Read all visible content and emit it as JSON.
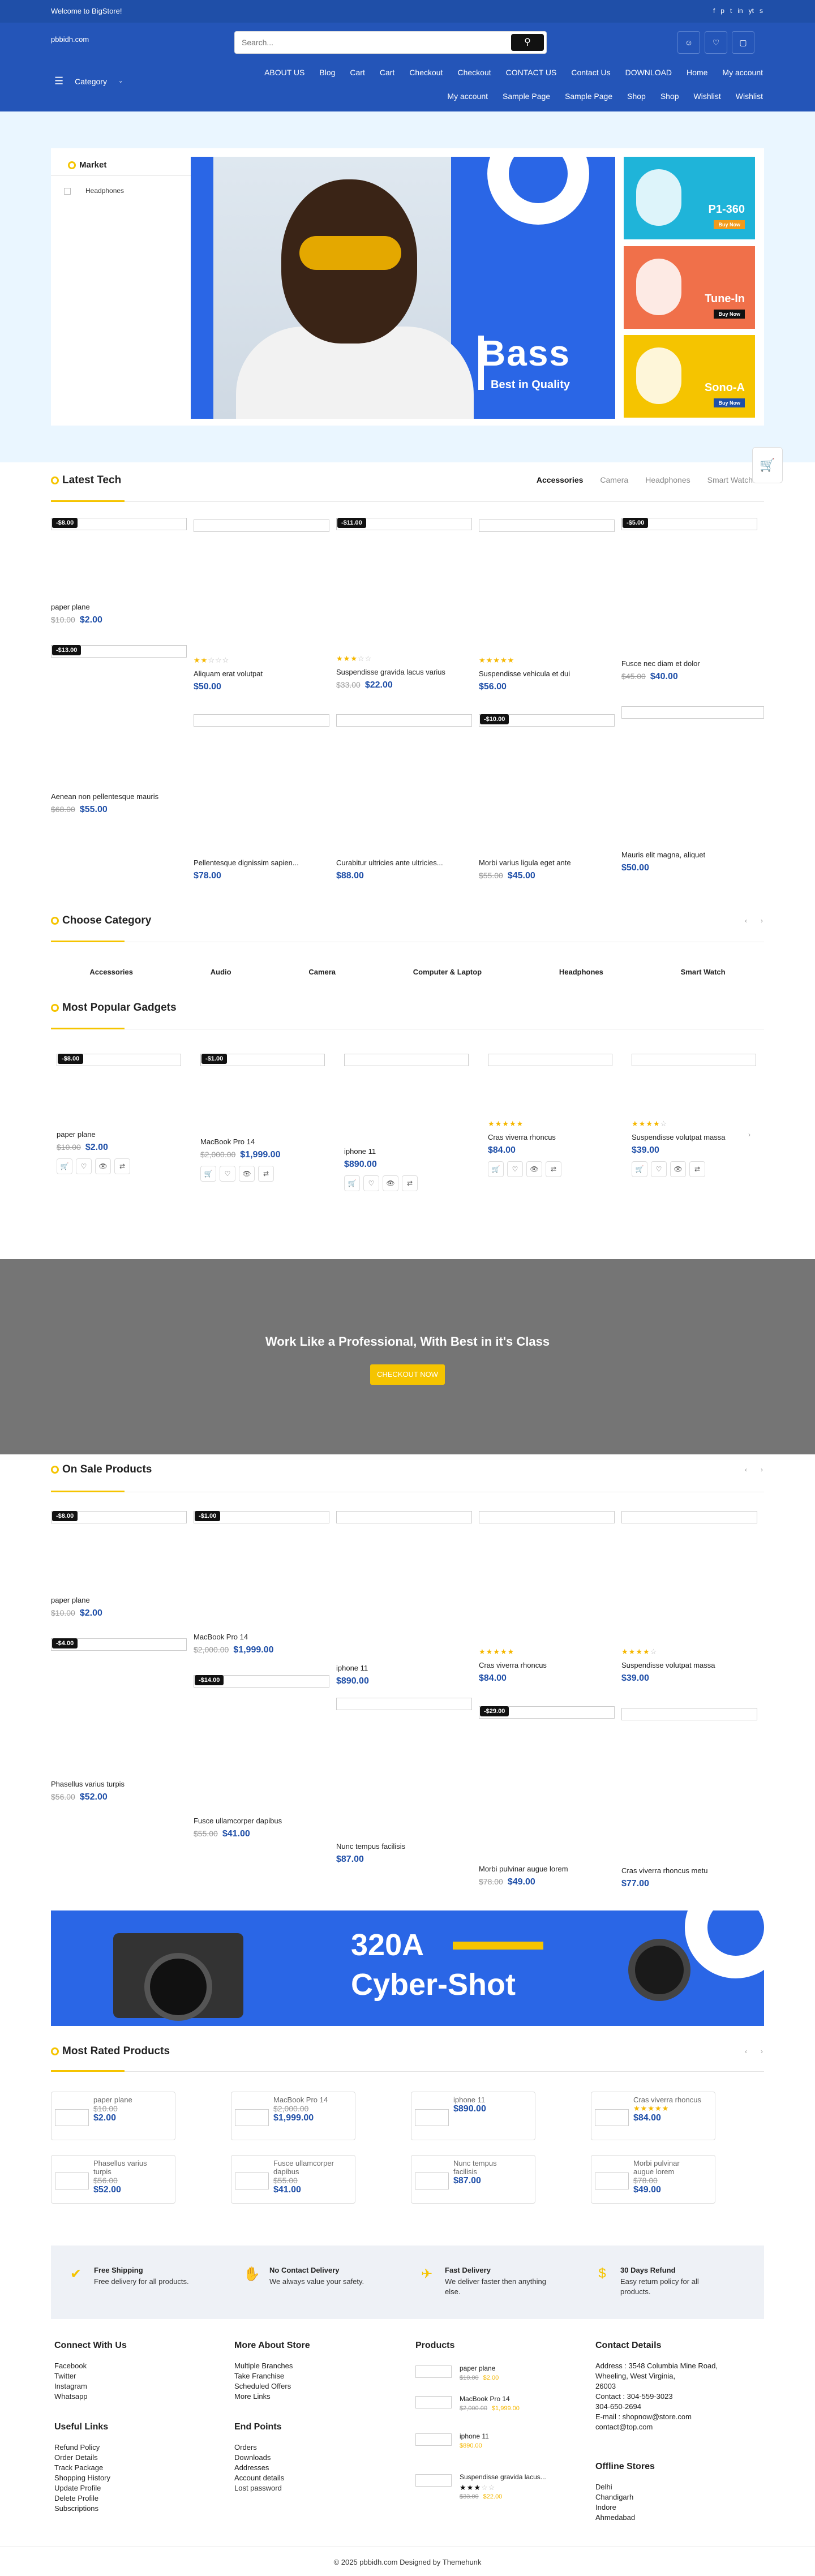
{
  "topbar": {
    "welcome": "Welcome to BigStore!",
    "social": [
      "f",
      "p",
      "t",
      "in",
      "yt",
      "s"
    ]
  },
  "header": {
    "logo_alt": "pbbidh.com",
    "search_placeholder": "Search...",
    "search_icon": "search-icon",
    "icons": [
      "user-icon",
      "heart-icon",
      "bag-icon"
    ]
  },
  "nav": {
    "category": "Category",
    "menu_row1": [
      "ABOUT US",
      "Blog",
      "Cart",
      "Cart",
      "Checkout",
      "Checkout",
      "CONTACT US",
      "Contact Us",
      "DOWNLOAD",
      "Home",
      "My account"
    ],
    "menu_row2": [
      "My account",
      "Sample Page",
      "Sample Page",
      "Shop",
      "Shop",
      "Wishlist",
      "Wishlist"
    ]
  },
  "hero": {
    "market": "Market",
    "sidebar_item": "Headphones",
    "main_title": "Bass",
    "main_sub": "Best in Quality",
    "banners": [
      {
        "title": "P1-360",
        "btn": "Buy Now",
        "bg": "#1fb4d9",
        "btncolor": "#f29a1a"
      },
      {
        "title": "Tune-In",
        "btn": "Buy Now",
        "bg": "#f0704a",
        "btncolor": "#111111"
      },
      {
        "title": "Sono-A",
        "btn": "Buy Now",
        "bg": "#f5c400",
        "btncolor": "#1f4fa8"
      }
    ]
  },
  "latest": {
    "title": "Latest Tech",
    "tabs": [
      "Accessories",
      "Camera",
      "Headphones",
      "Smart Watch"
    ],
    "row1": [
      {
        "badge": "-$8.00",
        "name": "paper plane",
        "old": "$10.00",
        "price": "$2.00"
      },
      {
        "name": "Aliquam erat volutpat",
        "price": "$50.00",
        "rating": 2
      },
      {
        "badge": "-$11.00",
        "name": "Suspendisse gravida lacus varius",
        "old": "$33.00",
        "price": "$22.00",
        "rating": 3
      },
      {
        "name": "Suspendisse vehicula et dui",
        "price": "$56.00",
        "rating": 5
      },
      {
        "badge": "-$5.00",
        "name": "Fusce nec diam et dolor",
        "old": "$45.00",
        "price": "$40.00"
      }
    ],
    "row2": [
      {
        "badge": "-$13.00",
        "name": "Aenean non pellentesque mauris",
        "old": "$68.00",
        "price": "$55.00"
      },
      {
        "name": "Pellentesque dignissim sapien...",
        "price": "$78.00"
      },
      {
        "name": "Curabitur ultricies ante ultricies...",
        "price": "$88.00"
      },
      {
        "badge": "-$10.00",
        "name": "Morbi varius ligula eget ante",
        "old": "$55.00",
        "price": "$45.00"
      },
      {
        "name": "Mauris elit magna, aliquet",
        "price": "$50.00"
      }
    ]
  },
  "category": {
    "title": "Choose Category",
    "items": [
      "Accessories",
      "Audio",
      "Camera",
      "Computer & Laptop",
      "Headphones",
      "Smart Watch"
    ]
  },
  "popular": {
    "title": "Most Popular Gadgets",
    "items": [
      {
        "badge": "-$8.00",
        "name": "paper plane",
        "old": "$10.00",
        "price": "$2.00"
      },
      {
        "badge": "-$1.00",
        "name": "MacBook Pro 14",
        "old": "$2,000.00",
        "price": "$1,999.00"
      },
      {
        "name": "iphone 11",
        "price": "$890.00"
      },
      {
        "name": "Cras viverra rhoncus",
        "price": "$84.00",
        "rating": 5
      },
      {
        "name": "Suspendisse volutpat massa",
        "price": "$39.00",
        "rating": 4
      }
    ]
  },
  "promo": {
    "title": "Work Like a Professional, With Best in it's Class",
    "button": "CHECKOUT NOW"
  },
  "onsale": {
    "title": "On Sale Products",
    "row1": [
      {
        "badge": "-$8.00",
        "name": "paper plane",
        "old": "$10.00",
        "price": "$2.00"
      },
      {
        "badge": "-$1.00",
        "name": "MacBook Pro 14",
        "old": "$2,000.00",
        "price": "$1,999.00"
      },
      {
        "name": "iphone 11",
        "price": "$890.00"
      },
      {
        "name": "Cras viverra rhoncus",
        "price": "$84.00",
        "rating": 5
      },
      {
        "name": "Suspendisse volutpat massa",
        "price": "$39.00",
        "rating": 4
      }
    ],
    "row2": [
      {
        "badge": "-$4.00",
        "name": "Phasellus varius turpis",
        "old": "$56.00",
        "price": "$52.00"
      },
      {
        "badge": "-$14.00",
        "name": "Fusce ullamcorper dapibus",
        "old": "$55.00",
        "price": "$41.00"
      },
      {
        "name": "Nunc tempus facilisis",
        "price": "$87.00"
      },
      {
        "badge": "-$29.00",
        "name": "Morbi pulvinar augue lorem",
        "old": "$78.00",
        "price": "$49.00"
      },
      {
        "name": "Cras viverra rhoncus metu",
        "price": "$77.00"
      }
    ]
  },
  "cyber": {
    "line1": "320A",
    "line2": "Cyber-Shot"
  },
  "rated": {
    "title": "Most Rated Products",
    "items": [
      {
        "name": "paper plane",
        "old": "$10.00",
        "price": "$2.00"
      },
      {
        "name": "MacBook Pro 14",
        "old": "$2,000.00",
        "price": "$1,999.00"
      },
      {
        "name": "iphone 11",
        "price": "$890.00"
      },
      {
        "name": "Cras viverra rhoncus",
        "price": "$84.00",
        "rating": 5
      },
      {
        "name": "Phasellus varius turpis",
        "old": "$56.00",
        "price": "$52.00"
      },
      {
        "name": "Fusce ullamcorper dapibus",
        "old": "$55.00",
        "price": "$41.00"
      },
      {
        "name": "Nunc tempus facilisis",
        "price": "$87.00"
      },
      {
        "name": "Morbi pulvinar augue lorem",
        "old": "$78.00",
        "price": "$49.00"
      }
    ]
  },
  "features": [
    {
      "icon": "✔",
      "title": "Free Shipping",
      "desc": "Free delivery for all products."
    },
    {
      "icon": "✋",
      "title": "No Contact Delivery",
      "desc": "We always value your safety."
    },
    {
      "icon": "✈",
      "title": "Fast Delivery",
      "desc": "We deliver faster then anything else."
    },
    {
      "icon": "$",
      "title": "30 Days Refund",
      "desc": "Easy return policy for all products."
    }
  ],
  "footer": {
    "connect": {
      "title": "Connect With Us",
      "items": [
        "Facebook",
        "Twitter",
        "Instagram",
        "Whatsapp"
      ]
    },
    "useful": {
      "title": "Useful Links",
      "items": [
        "Refund Policy",
        "Order Details",
        "Track Package",
        "Shopping History",
        "Update Profile",
        "Delete Profile",
        "Subscriptions"
      ]
    },
    "more": {
      "title": "More About Store",
      "items": [
        "Multiple Branches",
        "Take Franchise",
        "Scheduled Offers",
        "More Links"
      ]
    },
    "end": {
      "title": "End Points",
      "items": [
        "Orders",
        "Downloads",
        "Addresses",
        "Account details",
        "Lost password"
      ]
    },
    "products": {
      "title": "Products",
      "items": [
        {
          "name": "paper plane",
          "old": "$10.00",
          "price": "$2.00"
        },
        {
          "name": "MacBook Pro 14",
          "old": "$2,000.00",
          "price": "$1,999.00"
        },
        {
          "name": "iphone 11",
          "price": "$890.00"
        },
        {
          "name": "Suspendisse gravida lacus...",
          "old": "$33.00",
          "price": "$22.00",
          "rating": 3
        }
      ]
    },
    "contact": {
      "title": "Contact Details",
      "lines": [
        "Address : 3548 Columbia Mine Road,",
        "Wheeling, West Virginia,",
        "26003",
        "Contact : 304-559-3023",
        "304-650-2694",
        "E-mail : shopnow@store.com",
        "contact@top.com"
      ]
    },
    "offline": {
      "title": "Offline Stores",
      "items": [
        "Delhi",
        "Chandigarh",
        "Indore",
        "Ahmedabad"
      ]
    },
    "copyright": "© 2025 pbbidh.com Designed by Themehunk"
  }
}
